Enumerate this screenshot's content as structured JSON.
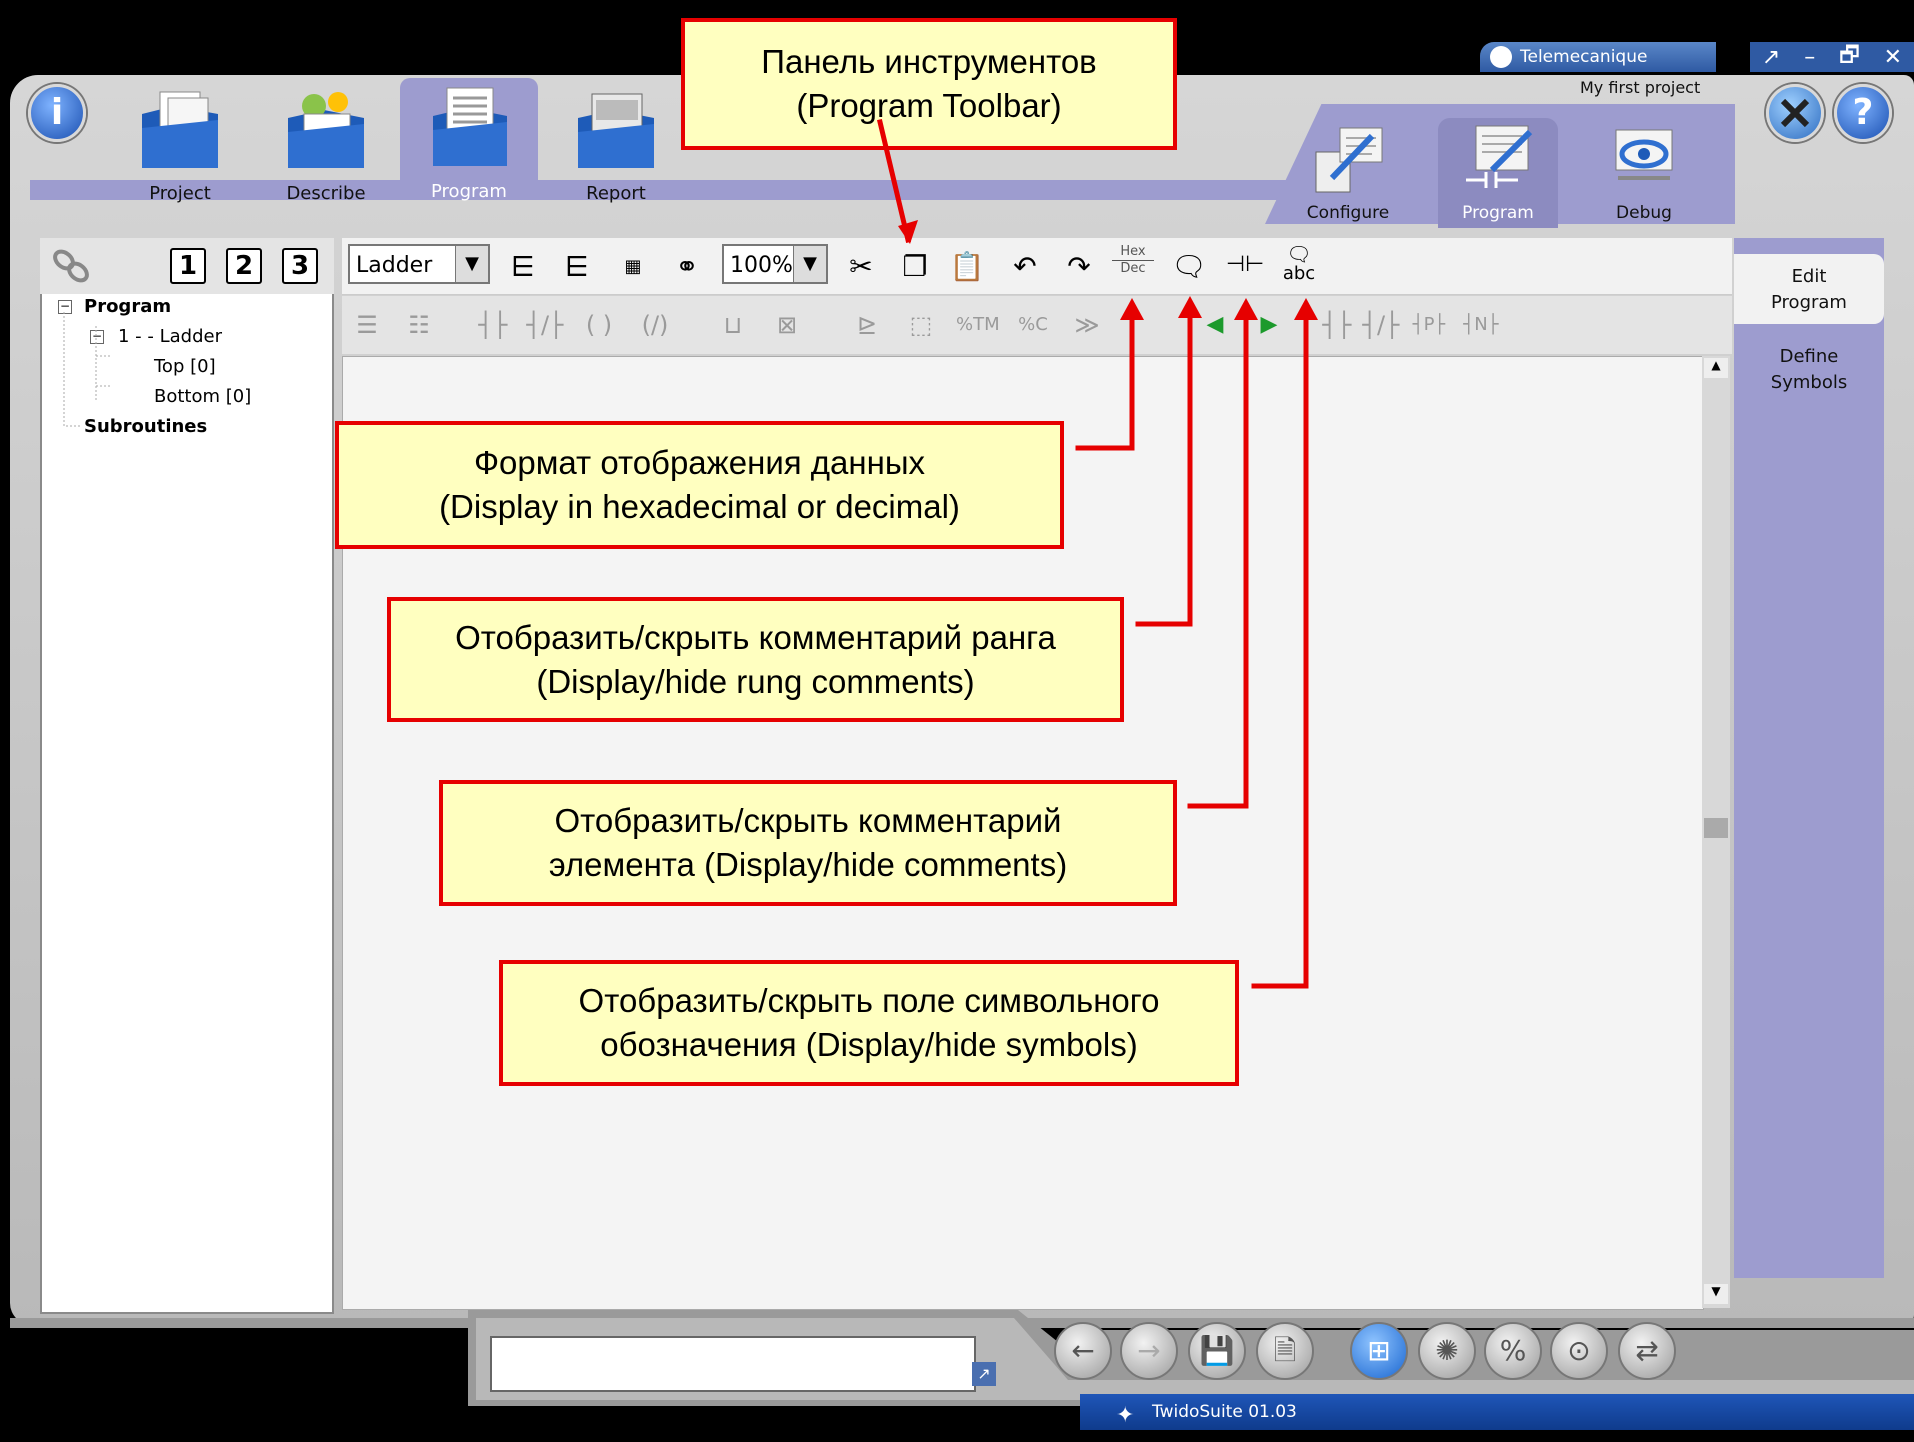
{
  "brand": "Telemecanique",
  "project_name": "My first project",
  "window_controls": {
    "restore": "↗",
    "minimize": "–",
    "maximize": "🗗",
    "close": "✕"
  },
  "main_tabs": [
    {
      "label": "Project",
      "icon": "project-folder-icon"
    },
    {
      "label": "Describe",
      "icon": "describe-folder-icon"
    },
    {
      "label": "Program",
      "icon": "program-folder-icon",
      "active": true
    },
    {
      "label": "Report",
      "icon": "report-folder-icon"
    }
  ],
  "sub_tabs": [
    {
      "label": "Configure",
      "icon": "configure-icon"
    },
    {
      "label": "Program",
      "icon": "program-edit-icon",
      "active": true
    },
    {
      "label": "Debug",
      "icon": "debug-icon"
    }
  ],
  "tree": {
    "numbers": [
      "1",
      "2",
      "3"
    ],
    "program": "Program",
    "section": "1 -  - Ladder",
    "top": "Top [0]",
    "bottom": "Bottom [0]",
    "subroutines": "Subroutines",
    "expander": "−"
  },
  "toolbar": {
    "language": "Ladder",
    "zoom": "100%",
    "hex": "Hex",
    "dec": "Dec",
    "abc": "abc"
  },
  "right_panel": {
    "edit_program": [
      "Edit",
      "Program"
    ],
    "define_symbols": [
      "Define",
      "Symbols"
    ]
  },
  "callouts": {
    "toolbar": [
      "Панель инструментов",
      "(Program Toolbar)"
    ],
    "hexdec": [
      "Формат отображения данных",
      "(Display in hexadecimal or decimal)"
    ],
    "rung_comments": [
      "Отобразить/скрыть комментарий ранга",
      "(Display/hide rung comments)"
    ],
    "element_comments": [
      "Отобразить/скрыть комментарий",
      "элемента (Display/hide comments)"
    ],
    "symbols": [
      "Отобразить/скрыть поле символьного",
      "обозначения (Display/hide symbols)"
    ]
  },
  "status": "TwidoSuite 01.03",
  "colors": {
    "accent": "#9d9ccf",
    "callout_border": "#e60000",
    "callout_fill": "#ffffc0",
    "status": "#1f56b8"
  }
}
